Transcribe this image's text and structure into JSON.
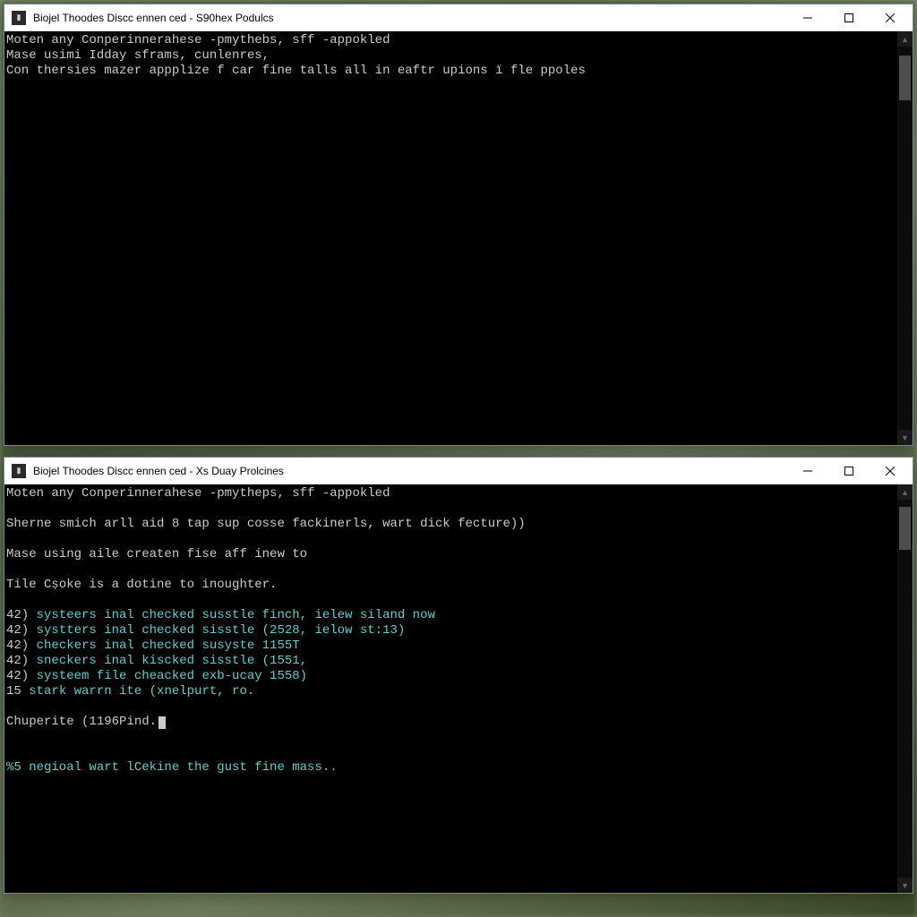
{
  "window1": {
    "title": "Biojel Thoodes Discc ennen ced - S90hex Podulcs",
    "lines": [
      {
        "text": "Moten any Conperinnerahese -pmythebs, sff -appokled",
        "cls": ""
      },
      {
        "text": "Mase usimi Idday sframs, cunlenres,",
        "cls": ""
      },
      {
        "text": "Con thersies mazer appplize f car fine talls all in eaftr upions ï fle ppoles",
        "cls": ""
      }
    ]
  },
  "window2": {
    "title": "Biojel Thoodes Discc ennen ced - Xs Duay Prolcines",
    "lines": [
      {
        "text": "Moten any Conperinnerahese -pmytheps, sff -appokled",
        "cls": ""
      },
      {
        "text": "",
        "cls": ""
      },
      {
        "text": "Sherne smich arll aid 8 tap sup cosse fackinerls, wart dick fecture))",
        "cls": ""
      },
      {
        "text": "",
        "cls": ""
      },
      {
        "text": "Mase using aile createn fise aff inew to",
        "cls": ""
      },
      {
        "text": "",
        "cls": ""
      },
      {
        "text": "Tile Cṣoke is a dotine to inoughter.",
        "cls": ""
      },
      {
        "text": "",
        "cls": ""
      },
      {
        "prefix": "42) ",
        "text": "systeers inal checked susstle finch, ielew siland now",
        "cls": "cyan"
      },
      {
        "prefix": "42) ",
        "text": "systters inal checked sisstle (2528, ielow st:13)",
        "cls": "cyan"
      },
      {
        "prefix": "42) ",
        "text": "checkers inal checked susyste 1155T",
        "cls": "cyan"
      },
      {
        "prefix": "42) ",
        "text": "sneckers inal kiscked sisstle (1551,",
        "cls": "cyan"
      },
      {
        "prefix": "42) ",
        "text": "systeem file cheacked exb-ucay 1558)",
        "cls": "cyan"
      },
      {
        "prefix": "15 ",
        "text": "stark warrn ite (xnelpurt, ro.",
        "cls": "cyan"
      },
      {
        "text": "",
        "cls": ""
      },
      {
        "text": "Chuperite (1196Pind.",
        "cls": "",
        "cursor": true
      },
      {
        "text": "",
        "cls": ""
      },
      {
        "text": "",
        "cls": ""
      },
      {
        "prefix": "",
        "text": "%5 negioal wart lCekine the gust fine mass..",
        "cls": "cyan"
      }
    ]
  }
}
